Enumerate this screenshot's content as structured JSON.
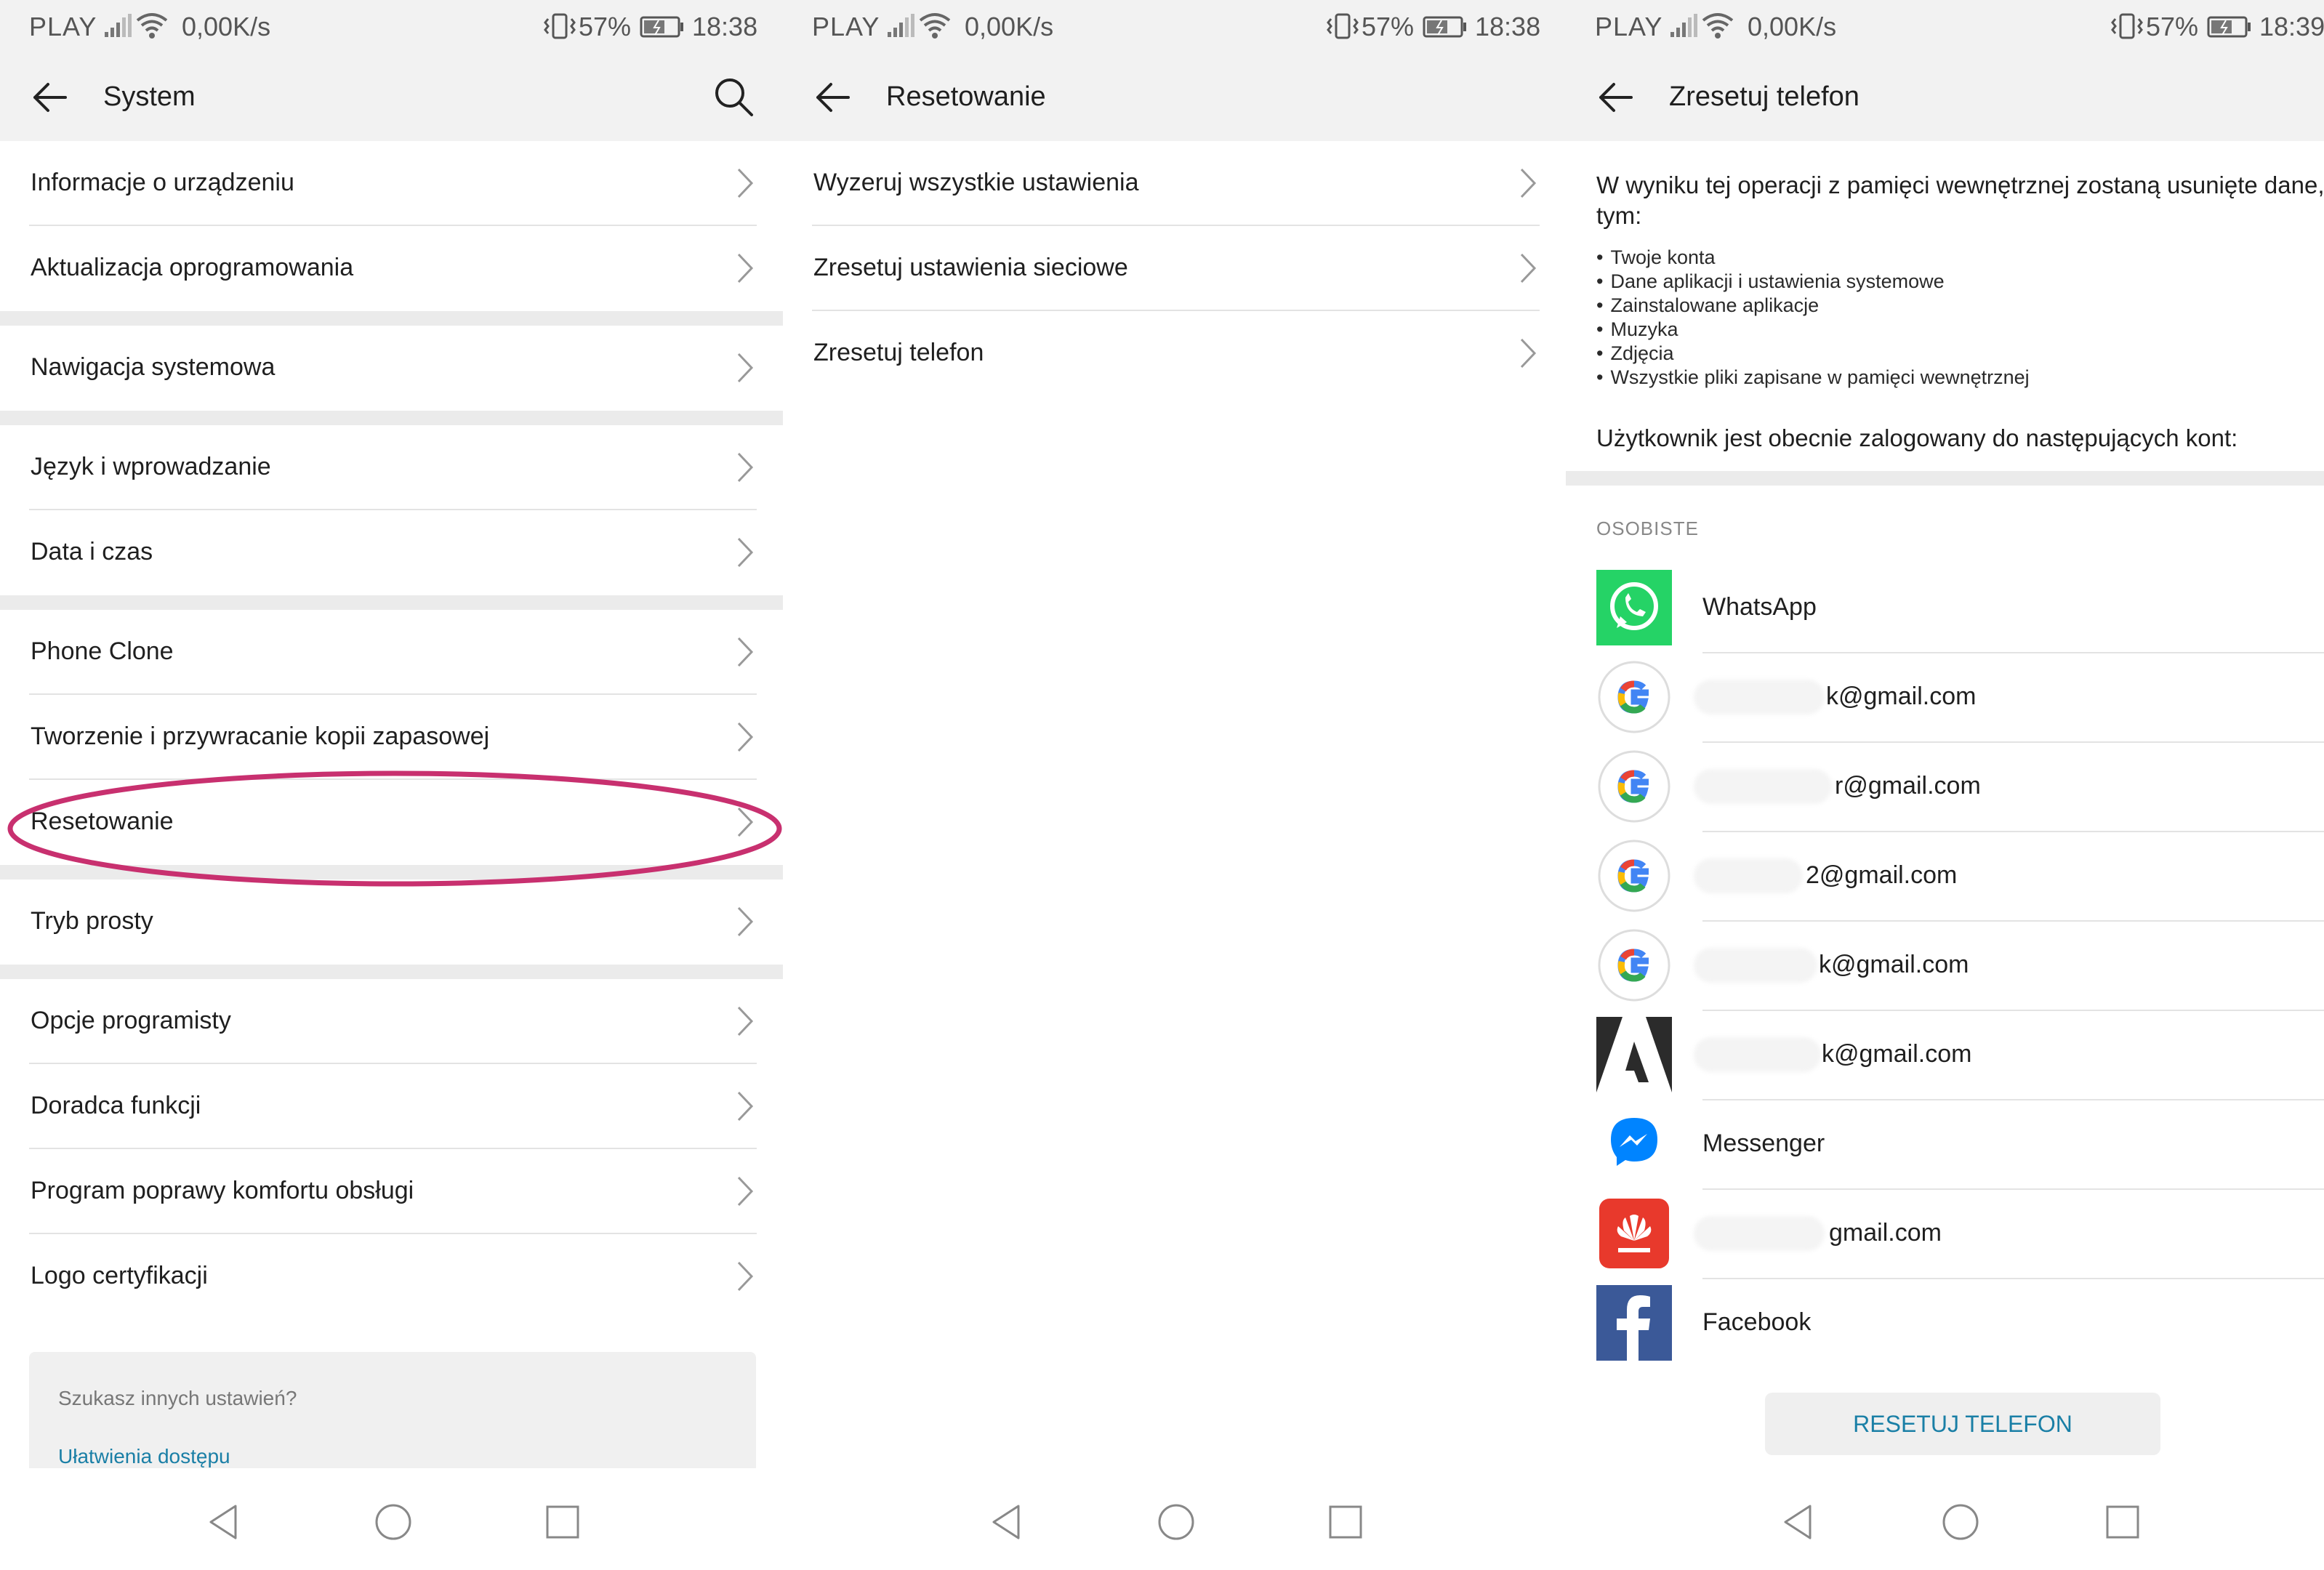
{
  "status_bar": {
    "carrier": "PLAY",
    "speed": "0,00K/s",
    "battery": "57%",
    "times": [
      "18:38",
      "18:38",
      "18:39"
    ]
  },
  "screen_system": {
    "title": "System",
    "items": [
      "Informacje o urządzeniu",
      "Aktualizacja oprogramowania",
      "Nawigacja systemowa",
      "Język i wprowadzanie",
      "Data i czas",
      "Phone Clone",
      "Tworzenie i przywracanie kopii zapasowej",
      "Resetowanie",
      "Tryb prosty",
      "Opcje programisty",
      "Doradca funkcji",
      "Program poprawy komfortu obsługi",
      "Logo certyfikacji"
    ],
    "highlighted_item": "Resetowanie",
    "suggest": {
      "title": "Szukasz innych ustawień?",
      "link": "Ułatwienia dostępu"
    }
  },
  "screen_reset": {
    "title": "Resetowanie",
    "items": [
      "Wyzeruj wszystkie ustawienia",
      "Zresetuj ustawienia sieciowe",
      "Zresetuj telefon"
    ]
  },
  "screen_factory": {
    "title": "Zresetuj telefon",
    "warning": "W wyniku tej operacji z pamięci wewnętrznej zostaną usunięte dane,",
    "warning_cont": "tym:",
    "bullets": [
      "Twoje konta",
      "Dane aplikacji i ustawienia systemowe",
      "Zainstalowane aplikacje",
      "Muzyka",
      "Zdjęcia",
      "Wszystkie pliki zapisane w pamięci wewnętrznej"
    ],
    "logged_in_text": "Użytkownik jest obecnie zalogowany do następujących kont:",
    "section_label": "OSOBISTE",
    "accounts": [
      {
        "icon": "whatsapp-icon",
        "label": "WhatsApp"
      },
      {
        "icon": "google-icon",
        "label": "k@gmail.com"
      },
      {
        "icon": "google-icon",
        "label": "r@gmail.com"
      },
      {
        "icon": "google-icon",
        "label": "2@gmail.com"
      },
      {
        "icon": "google-icon",
        "label": "k@gmail.com"
      },
      {
        "icon": "adobe-icon",
        "label": "k@gmail.com"
      },
      {
        "icon": "messenger-icon",
        "label": "Messenger"
      },
      {
        "icon": "huawei-icon",
        "label": "gmail.com"
      },
      {
        "icon": "facebook-icon",
        "label": "Facebook"
      }
    ],
    "reset_button": "RESETUJ TELEFON"
  },
  "colors": {
    "accent": "#1a7fa6",
    "highlight_ring": "#c8306f",
    "whatsapp": "#25d366",
    "facebook": "#3b5998",
    "huawei": "#e8392c",
    "messenger": "#0084ff"
  }
}
